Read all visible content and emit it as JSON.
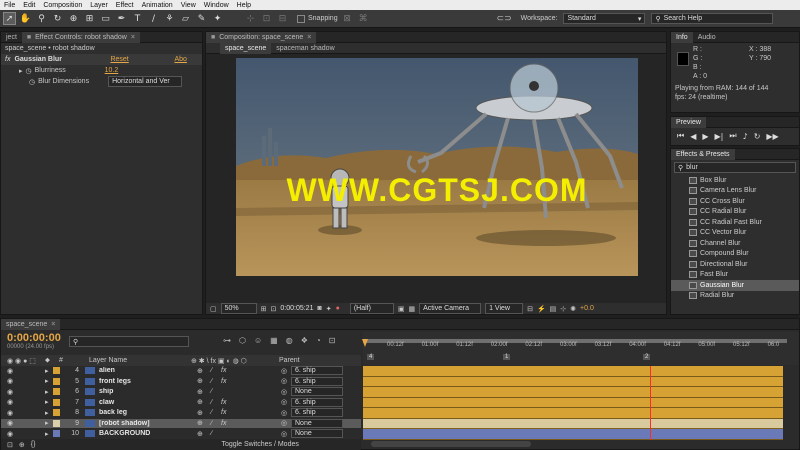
{
  "menu": [
    "File",
    "Edit",
    "Composition",
    "Layer",
    "Effect",
    "Animation",
    "View",
    "Window",
    "Help"
  ],
  "toolbar": {
    "snapping": "Snapping",
    "workspace_label": "Workspace:",
    "workspace_value": "Standard",
    "search_placeholder": "Search Help"
  },
  "effect_controls": {
    "tab_project": "ject",
    "tab_label": "Effect Controls: robot shadow",
    "path": "space_scene • robot shadow",
    "effect": "Gaussian Blur",
    "reset": "Reset",
    "about": "Abo",
    "blurriness_label": "Blurriness",
    "blurriness_value": "10.2",
    "dimensions_label": "Blur Dimensions",
    "dimensions_value": "Horizontal and Ver"
  },
  "composition": {
    "tab_label": "Composition: space_scene",
    "sub_tab_1": "space_scene",
    "sub_tab_2": "spaceman shadow",
    "watermark": "WWW.CGTSJ.COM",
    "zoom": "50%",
    "timecode": "0:00:05:21",
    "resolution": "(Half)",
    "camera": "Active Camera",
    "views": "1 View",
    "exposure": "+0.0"
  },
  "info": {
    "tab": "Info",
    "tab2": "Audio",
    "r": "R :",
    "g": "G :",
    "b": "B :",
    "a": "A : 0",
    "x": "X : 388",
    "y": "Y : 790",
    "playing": "Playing from RAM: 144 of 144",
    "fps": "fps: 24 (realtime)"
  },
  "preview": {
    "tab": "Preview"
  },
  "effects_presets": {
    "tab": "Effects & Presets",
    "search": "blur",
    "items": [
      "Box Blur",
      "Camera Lens Blur",
      "CC Cross Blur",
      "CC Radial Blur",
      "CC Radial Fast Blur",
      "CC Vector Blur",
      "Channel Blur",
      "Compound Blur",
      "Directional Blur",
      "Fast Blur",
      "Gaussian Blur",
      "Radial Blur"
    ],
    "selected_index": 10
  },
  "timeline": {
    "tab": "space_scene",
    "timecode": "0:00:00:00",
    "frames": "00000 (24.00 fps)",
    "search_placeholder": "",
    "col_num": "#",
    "col_layer_name": "Layer Name",
    "col_parent": "Parent",
    "ruler": [
      "00:12f",
      "01:00f",
      "01:12f",
      "02:00f",
      "02:12f",
      "03:00f",
      "03:12f",
      "04:00f",
      "04:12f",
      "05:00f",
      "05:12f",
      "06:0"
    ],
    "markers": [
      "4",
      "1",
      "2"
    ],
    "layers": [
      {
        "num": "4",
        "name": "alien",
        "parent": "6. ship",
        "fx": true,
        "color": "#d6a233",
        "selected": false
      },
      {
        "num": "5",
        "name": "front legs",
        "parent": "6. ship",
        "fx": true,
        "color": "#d6a233",
        "selected": false
      },
      {
        "num": "6",
        "name": "ship",
        "parent": "None",
        "fx": false,
        "color": "#d6a233",
        "selected": false
      },
      {
        "num": "7",
        "name": "claw",
        "parent": "6. ship",
        "fx": true,
        "color": "#d6a233",
        "selected": false
      },
      {
        "num": "8",
        "name": "back leg",
        "parent": "6. ship",
        "fx": true,
        "color": "#d6a233",
        "selected": false
      },
      {
        "num": "9",
        "name": "[robot shadow]",
        "parent": "None",
        "fx": true,
        "color": "#d9cfa8",
        "selected": true
      },
      {
        "num": "10",
        "name": "BACKGROUND",
        "parent": "None",
        "fx": false,
        "color": "#6a7ab8",
        "selected": false
      }
    ],
    "toggle_label": "Toggle Switches / Modes"
  }
}
